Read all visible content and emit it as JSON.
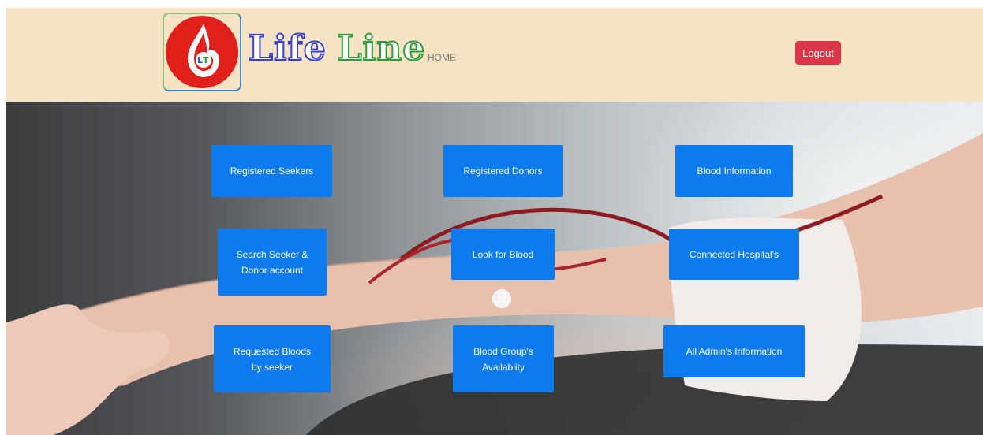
{
  "header": {
    "logo_icon": "blood-drop-logo",
    "brand_first": "Life",
    "brand_second": "Line",
    "home_label": "HOME",
    "logout_label": "Logout"
  },
  "tiles": [
    {
      "label": "Registered Seekers"
    },
    {
      "label": "Registered Donors"
    },
    {
      "label": "Blood Information"
    },
    {
      "label": "Search Seeker &\nDonor account"
    },
    {
      "label": "Look for Blood"
    },
    {
      "label": "Connected Hospital's"
    },
    {
      "label": "Requested Bloods\nby seeker"
    },
    {
      "label": "Blood Group's\nAvailablity"
    },
    {
      "label": "All Admin's Information"
    }
  ],
  "colors": {
    "navbar": "#f5e3c3",
    "tile": "#0d7bf0",
    "logout": "#dc3545",
    "logo_red": "#e0211b"
  }
}
